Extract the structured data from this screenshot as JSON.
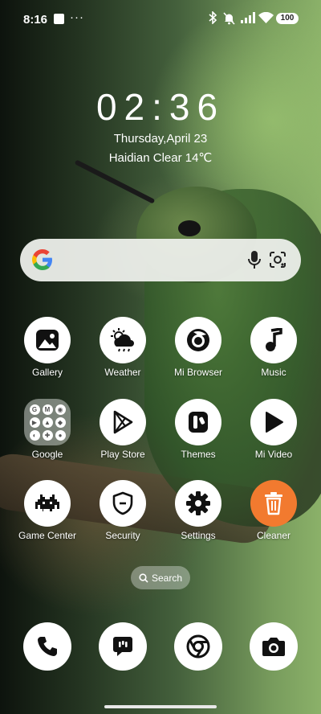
{
  "status_bar": {
    "time": "8:16",
    "more": "···",
    "battery": "100"
  },
  "clock_widget": {
    "time": "02:36",
    "date": "Thursday,April 23",
    "weather": "Haidian Clear 14℃"
  },
  "search_bar": {
    "logo_icon": "google-g-icon",
    "mic_icon": "microphone-icon",
    "lens_icon": "google-lens-icon"
  },
  "apps": [
    {
      "label": "Gallery",
      "icon": "gallery-icon"
    },
    {
      "label": "Weather",
      "icon": "weather-icon"
    },
    {
      "label": "Mi Browser",
      "icon": "mi-browser-icon"
    },
    {
      "label": "Music",
      "icon": "music-icon"
    },
    {
      "label": "Google",
      "icon": "google-folder-icon"
    },
    {
      "label": "Play Store",
      "icon": "play-store-icon"
    },
    {
      "label": "Themes",
      "icon": "themes-icon"
    },
    {
      "label": "Mi Video",
      "icon": "mi-video-icon"
    },
    {
      "label": "Game Center",
      "icon": "game-center-icon"
    },
    {
      "label": "Security",
      "icon": "security-icon"
    },
    {
      "label": "Settings",
      "icon": "settings-icon"
    },
    {
      "label": "Cleaner",
      "icon": "cleaner-icon"
    }
  ],
  "app_search": {
    "label": "Search"
  },
  "dock": [
    {
      "icon": "phone-icon"
    },
    {
      "icon": "messages-icon"
    },
    {
      "icon": "chrome-icon"
    },
    {
      "icon": "camera-icon"
    }
  ],
  "colors": {
    "cleaner_accent": "#f27a2f",
    "icon_bg": "#ffffff",
    "icon_glyph": "#111111"
  }
}
